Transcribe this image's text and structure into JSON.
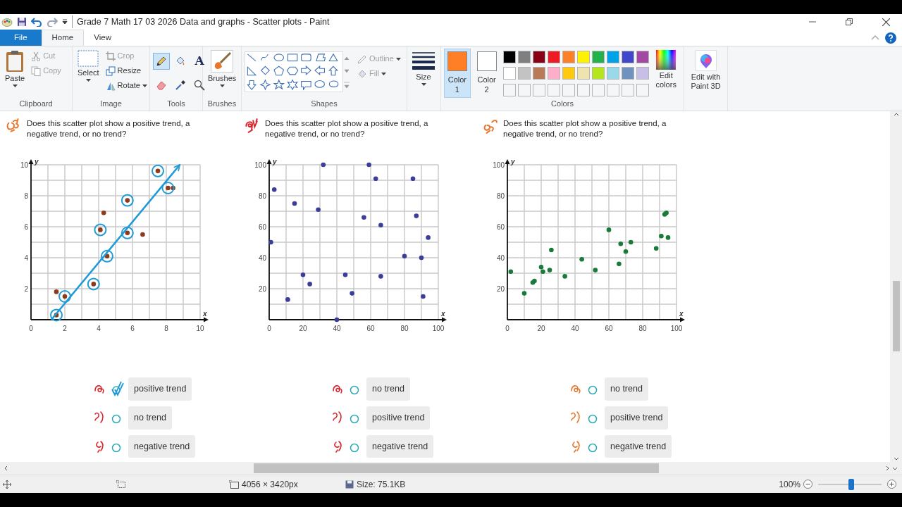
{
  "window": {
    "title": "Grade 7 Math 17 03 2026 Data and graphs - Scatter plots - Paint"
  },
  "ribbon_tabs": [
    {
      "label": "File",
      "kind": "file",
      "selected": false
    },
    {
      "label": "Home",
      "kind": "tab",
      "selected": true
    },
    {
      "label": "View",
      "kind": "tab",
      "selected": false
    }
  ],
  "clipboard": {
    "label": "Clipboard",
    "paste": "Paste",
    "items": [
      {
        "label": "Cut",
        "kind": "cut",
        "disabled": true
      },
      {
        "label": "Copy",
        "kind": "copy",
        "disabled": true
      }
    ]
  },
  "image": {
    "label": "Image",
    "select": "Select",
    "items": [
      {
        "label": "Crop",
        "kind": "crop",
        "disabled": true
      },
      {
        "label": "Resize",
        "kind": "resize",
        "disabled": false
      },
      {
        "label": "Rotate",
        "kind": "rotate",
        "disabled": false
      }
    ]
  },
  "tools": {
    "label": "Tools",
    "items": [
      {
        "kind": "pencil",
        "selected": true
      },
      {
        "kind": "fill",
        "selected": false
      },
      {
        "kind": "text",
        "glyph": "A",
        "selected": false
      },
      {
        "kind": "eraser",
        "selected": false
      },
      {
        "kind": "picker",
        "selected": false
      },
      {
        "kind": "magnifier",
        "selected": false
      }
    ]
  },
  "brushes": {
    "button": "Brushes",
    "label": "Brushes"
  },
  "shapes": {
    "label": "Shapes",
    "outline": "Outline",
    "fill": "Fill"
  },
  "size": {
    "label": "Size"
  },
  "colors": {
    "label": "Colors",
    "edit": "Edit colors",
    "active": [
      {
        "label": "Color 1",
        "color": "#ff7f27",
        "selected": true
      },
      {
        "label": "Color 2",
        "color": "#ffffff",
        "selected": false
      }
    ],
    "palette": [
      {
        "color": "#000000"
      },
      {
        "color": "#7f7f7f"
      },
      {
        "color": "#880015"
      },
      {
        "color": "#ed1c24"
      },
      {
        "color": "#ff7f27"
      },
      {
        "color": "#fff200"
      },
      {
        "color": "#22b14c"
      },
      {
        "color": "#00a2e8"
      },
      {
        "color": "#3f48cc"
      },
      {
        "color": "#a349a4"
      },
      {
        "color": "#ffffff"
      },
      {
        "color": "#c3c3c3"
      },
      {
        "color": "#b97a57"
      },
      {
        "color": "#ffaec9"
      },
      {
        "color": "#ffc90e"
      },
      {
        "color": "#efe4b0"
      },
      {
        "color": "#b5e61d"
      },
      {
        "color": "#99d9ea"
      },
      {
        "color": "#7092be"
      },
      {
        "color": "#c8bfe7"
      }
    ]
  },
  "paint3d": {
    "label": "Edit with Paint 3D"
  },
  "questions": [
    {
      "prompt": "Does this scatter plot show a positive trend, a negative trend, or no trend?",
      "color": "#e8772e",
      "hand_circles": [
        true,
        false,
        true,
        true,
        true,
        false,
        true,
        true,
        true,
        false,
        true,
        true,
        false
      ],
      "chart_data": {
        "type": "scatter",
        "xlabel": "x",
        "ylabel": "y",
        "xlim": [
          0,
          10
        ],
        "ylim": [
          0,
          10
        ],
        "xticks": [
          0,
          2,
          4,
          6,
          8,
          10
        ],
        "yticks": [
          2,
          4,
          6,
          8,
          10
        ],
        "grid": true,
        "series": [
          {
            "color": "#8b3a1e",
            "x": [
              1.5,
              1.5,
              2,
              3.7,
              4.1,
              4.3,
              4.5,
              5.7,
              5.7,
              6.6,
              7.5,
              8.1,
              8.4
            ],
            "values": [
              0.3,
              1.8,
              1.5,
              2.3,
              5.8,
              6.9,
              4.1,
              7.7,
              5.6,
              5.5,
              9.6,
              8.5,
              8.5
            ]
          },
          {
            "type": "line",
            "color": "#1f9ad6",
            "x": [
              1.2,
              8.8
            ],
            "values": [
              0,
              10
            ]
          }
        ]
      },
      "options": [
        {
          "label": "positive trend",
          "checked": true,
          "color": "#d9262e"
        },
        {
          "label": "no trend",
          "checked": false,
          "color": "#d9262e"
        },
        {
          "label": "negative trend",
          "checked": false,
          "color": "#d9262e"
        }
      ]
    },
    {
      "prompt": "Does this scatter plot show a positive trend, a negative trend, or no trend?",
      "color": "#d9262e",
      "chart_data": {
        "type": "scatter",
        "xlabel": "x",
        "ylabel": "y",
        "xlim": [
          0,
          100
        ],
        "ylim": [
          0,
          100
        ],
        "xticks": [
          0,
          20,
          40,
          60,
          80,
          100
        ],
        "yticks": [
          20,
          40,
          60,
          80,
          100
        ],
        "grid": true,
        "series": [
          {
            "color": "#3a3d9a",
            "x": [
              1,
              3,
              11,
              15,
              20,
              24,
              29,
              32,
              40,
              45,
              49,
              56,
              59,
              63,
              66,
              66,
              80,
              85,
              87,
              90,
              91,
              94
            ],
            "values": [
              50,
              84,
              13,
              75,
              29,
              23,
              71,
              100,
              0,
              29,
              17,
              66,
              100,
              91,
              61,
              28,
              41,
              91,
              67,
              40,
              15,
              53
            ]
          }
        ]
      },
      "options": [
        {
          "label": "no trend",
          "checked": false,
          "color": "#d9262e"
        },
        {
          "label": "positive trend",
          "checked": false,
          "color": "#d9262e"
        },
        {
          "label": "negative trend",
          "checked": false,
          "color": "#d9262e"
        }
      ]
    },
    {
      "prompt": "Does this scatter plot show a positive trend, a negative trend, or no trend?",
      "color": "#e8772e",
      "chart_data": {
        "type": "scatter",
        "xlabel": "x",
        "ylabel": "y",
        "xlim": [
          0,
          100
        ],
        "ylim": [
          0,
          100
        ],
        "xticks": [
          0,
          20,
          40,
          60,
          80,
          100
        ],
        "yticks": [
          20,
          40,
          60,
          80,
          100
        ],
        "grid": true,
        "series": [
          {
            "color": "#1a7a3a",
            "x": [
              2,
              10,
              15,
              16,
              20,
              21,
              25,
              26,
              34,
              44,
              52,
              60,
              66,
              67,
              70,
              73,
              88,
              91,
              93,
              94,
              95
            ],
            "values": [
              31,
              17,
              24,
              25,
              34,
              31,
              32,
              45,
              28,
              39,
              32,
              58,
              36,
              49,
              44,
              50,
              46,
              54,
              68,
              69,
              53
            ]
          }
        ]
      },
      "options": [
        {
          "label": "no trend",
          "checked": false,
          "color": "#e8772e"
        },
        {
          "label": "positive trend",
          "checked": false,
          "color": "#e8772e"
        },
        {
          "label": "negative trend",
          "checked": false,
          "color": "#e8772e"
        }
      ]
    }
  ],
  "status_bar": {
    "dimensions": "4056 × 3420px",
    "size": "Size: 75.1KB",
    "zoom": "100%",
    "level": 0.53
  }
}
